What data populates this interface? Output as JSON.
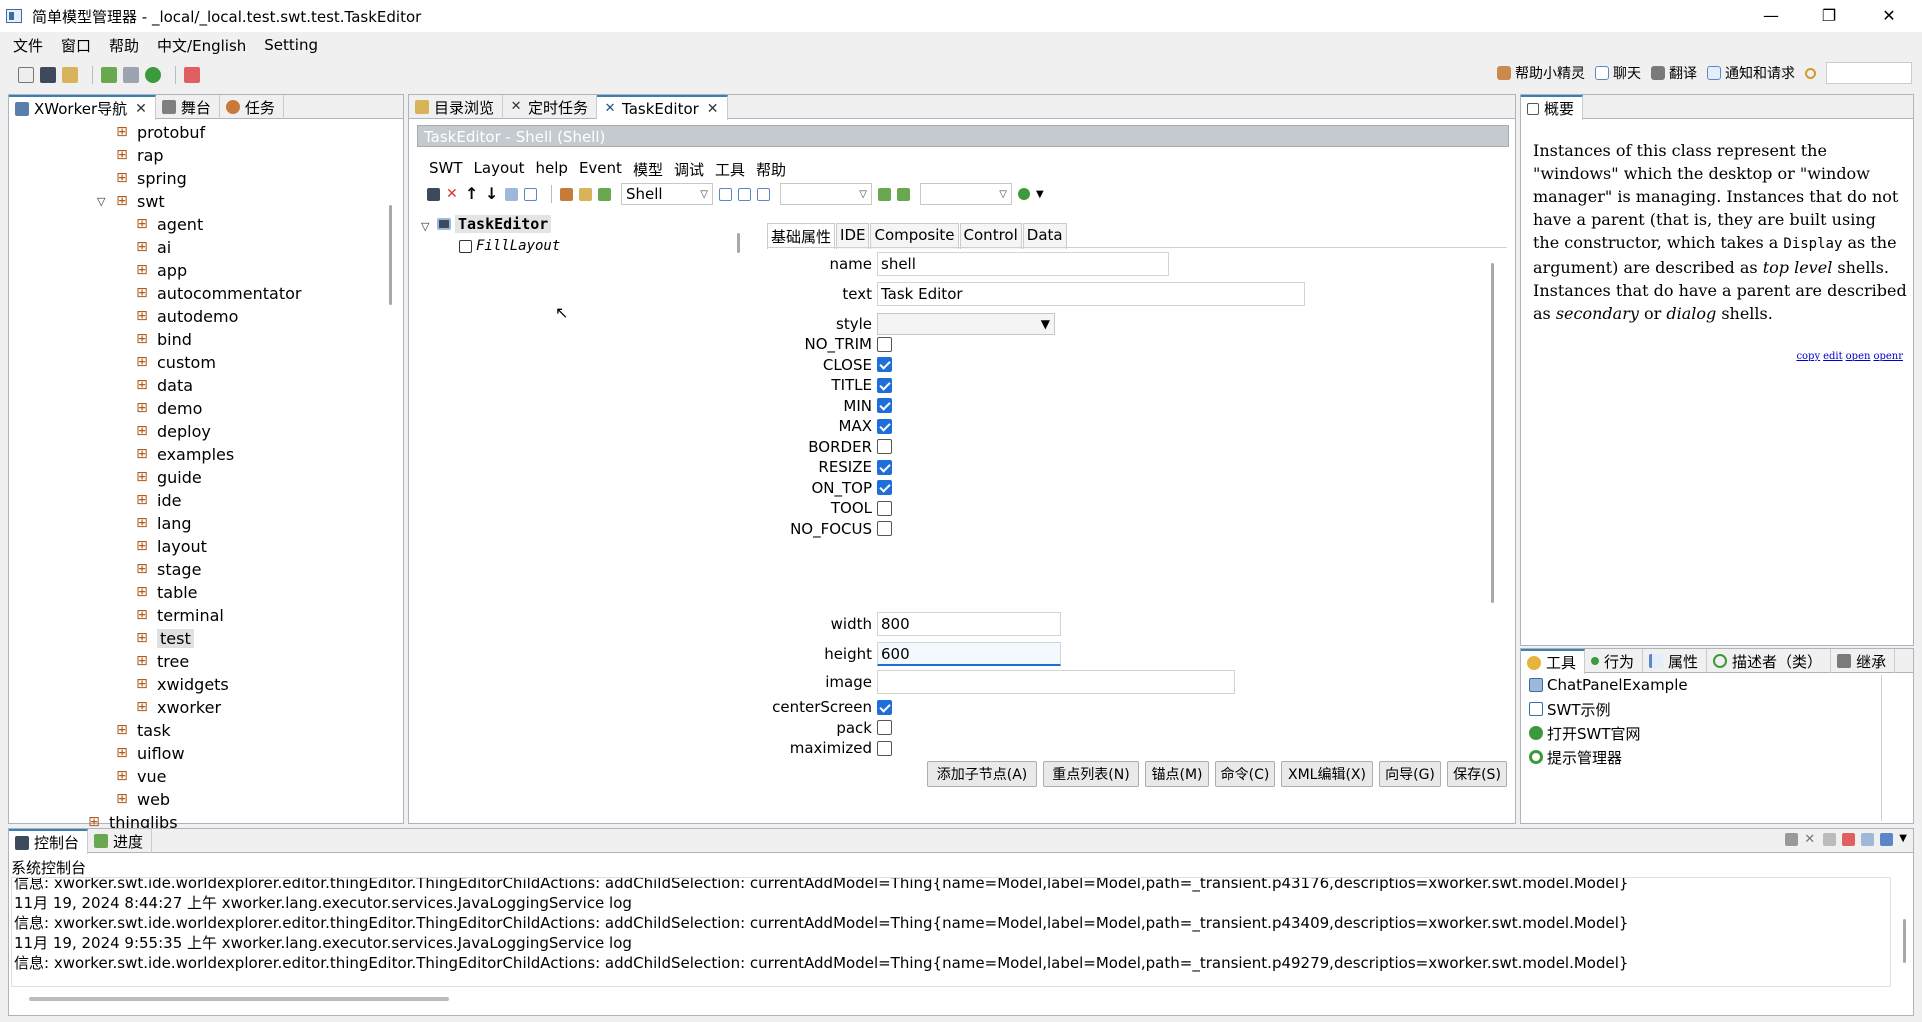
{
  "window": {
    "title": "简单模型管理器 - _local/_local.test.swt.test.TaskEditor",
    "minimize": "—",
    "maximize": "❐",
    "close": "✕"
  },
  "menu": [
    "文件",
    "窗口",
    "帮助",
    "中文/English",
    "Setting"
  ],
  "right_toolbar": {
    "items": [
      "帮助小精灵",
      "聊天",
      "翻译",
      "通知和请求"
    ],
    "search_value": ""
  },
  "nav": {
    "tabs": [
      "XWorker导航",
      "舞台",
      "任务"
    ],
    "tree": [
      {
        "label": "protobuf",
        "level": 1
      },
      {
        "label": "rap",
        "level": 1
      },
      {
        "label": "spring",
        "level": 1
      },
      {
        "label": "swt",
        "level": 1,
        "expanded": true
      },
      {
        "label": "agent",
        "level": 2
      },
      {
        "label": "ai",
        "level": 2
      },
      {
        "label": "app",
        "level": 2
      },
      {
        "label": "autocommentator",
        "level": 2
      },
      {
        "label": "autodemo",
        "level": 2
      },
      {
        "label": "bind",
        "level": 2
      },
      {
        "label": "custom",
        "level": 2
      },
      {
        "label": "data",
        "level": 2
      },
      {
        "label": "demo",
        "level": 2
      },
      {
        "label": "deploy",
        "level": 2
      },
      {
        "label": "examples",
        "level": 2
      },
      {
        "label": "guide",
        "level": 2
      },
      {
        "label": "ide",
        "level": 2
      },
      {
        "label": "lang",
        "level": 2
      },
      {
        "label": "layout",
        "level": 2
      },
      {
        "label": "stage",
        "level": 2
      },
      {
        "label": "table",
        "level": 2
      },
      {
        "label": "terminal",
        "level": 2
      },
      {
        "label": "test",
        "level": 2,
        "selected": true
      },
      {
        "label": "tree",
        "level": 2
      },
      {
        "label": "xwidgets",
        "level": 2
      },
      {
        "label": "xworker",
        "level": 2
      },
      {
        "label": "task",
        "level": 1
      },
      {
        "label": "uiflow",
        "level": 1
      },
      {
        "label": "vue",
        "level": 1
      },
      {
        "label": "web",
        "level": 1
      },
      {
        "label": "thinglibs",
        "level": 0
      }
    ]
  },
  "editor": {
    "tabs": [
      "目录浏览",
      "定时任务",
      "TaskEditor"
    ],
    "header": "TaskEditor - Shell  (Shell)",
    "menu": [
      "SWT",
      "Layout",
      "help",
      "Event",
      "模型",
      "调试",
      "工具",
      "帮助"
    ],
    "type_combo": "Shell",
    "outline": {
      "root": "TaskEditor",
      "child": "FillLayout"
    },
    "prop_tabs": [
      "基础属性",
      "IDE",
      "Composite",
      "Control",
      "Data"
    ],
    "fields": {
      "name_label": "name",
      "name_value": "shell",
      "text_label": "text",
      "text_value": "Task Editor",
      "style_label": "style",
      "width_label": "width",
      "width_value": "800",
      "height_label": "height",
      "height_value": "600",
      "image_label": "image",
      "image_value": ""
    },
    "checks": [
      {
        "label": "NO_TRIM",
        "checked": false
      },
      {
        "label": "CLOSE",
        "checked": true
      },
      {
        "label": "TITLE",
        "checked": true
      },
      {
        "label": "MIN",
        "checked": true
      },
      {
        "label": "MAX",
        "checked": true
      },
      {
        "label": "BORDER",
        "checked": false
      },
      {
        "label": "RESIZE",
        "checked": true
      },
      {
        "label": "ON_TOP",
        "checked": true
      },
      {
        "label": "TOOL",
        "checked": false
      },
      {
        "label": "NO_FOCUS",
        "checked": false
      }
    ],
    "checks2": [
      {
        "label": "centerScreen",
        "checked": true
      },
      {
        "label": "pack",
        "checked": false
      },
      {
        "label": "maximized",
        "checked": false
      }
    ],
    "buttons": [
      "添加子节点(A)",
      "重点列表(N)",
      "锚点(M)",
      "命令(C)",
      "XML编辑(X)",
      "向导(G)",
      "保存(S)"
    ]
  },
  "summary": {
    "tab": "概要",
    "p1": "Instances of this class represent the \"windows\" which the desktop or \"window manager\" is managing. Instances that do not have a parent (that is, they are built using the constructor, which takes a ",
    "code": "Display",
    "p2": " as the argument) are described as ",
    "em1": "top level",
    "p3": " shells. Instances that do have a parent are described as ",
    "em2": "secondary",
    "p4": " or ",
    "em3": "dialog",
    "p5": " shells.",
    "links": [
      "copy",
      "edit",
      "open",
      "openr"
    ]
  },
  "tools": {
    "tabs": [
      "工具",
      "行为",
      "属性",
      "描述者（类）",
      "继承"
    ],
    "items": [
      "ChatPanelExample",
      "SWT示例",
      "打开SWT官网",
      "提示管理器"
    ]
  },
  "console": {
    "tabs": [
      "控制台",
      "进度"
    ],
    "label": "系统控制台",
    "lines": [
      "信息: xworker.swt.ide.worldexplorer.editor.thingEditor.ThingEditorChildActions: addChildSelection: currentAddModel=Thing{name=Model,label=Model,path=_transient.p43176,descriptios=xworker.swt.model.Model}",
      "11月 19, 2024 8:44:27 上午 xworker.lang.executor.services.JavaLoggingService log",
      "信息: xworker.swt.ide.worldexplorer.editor.thingEditor.ThingEditorChildActions: addChildSelection: currentAddModel=Thing{name=Model,label=Model,path=_transient.p43409,descriptios=xworker.swt.model.Model}",
      "11月 19, 2024 9:55:35 上午 xworker.lang.executor.services.JavaLoggingService log",
      "信息: xworker.swt.ide.worldexplorer.editor.thingEditor.ThingEditorChildActions: addChildSelection: currentAddModel=Thing{name=Model,label=Model,path=_transient.p49279,descriptios=xworker.swt.model.Model}"
    ]
  },
  "colors": {
    "accent": "#1e6fd9",
    "tab_active_border": "#3c7fb1",
    "header_bg": "#c5c9d0",
    "package_icon": "#b05a1c"
  }
}
